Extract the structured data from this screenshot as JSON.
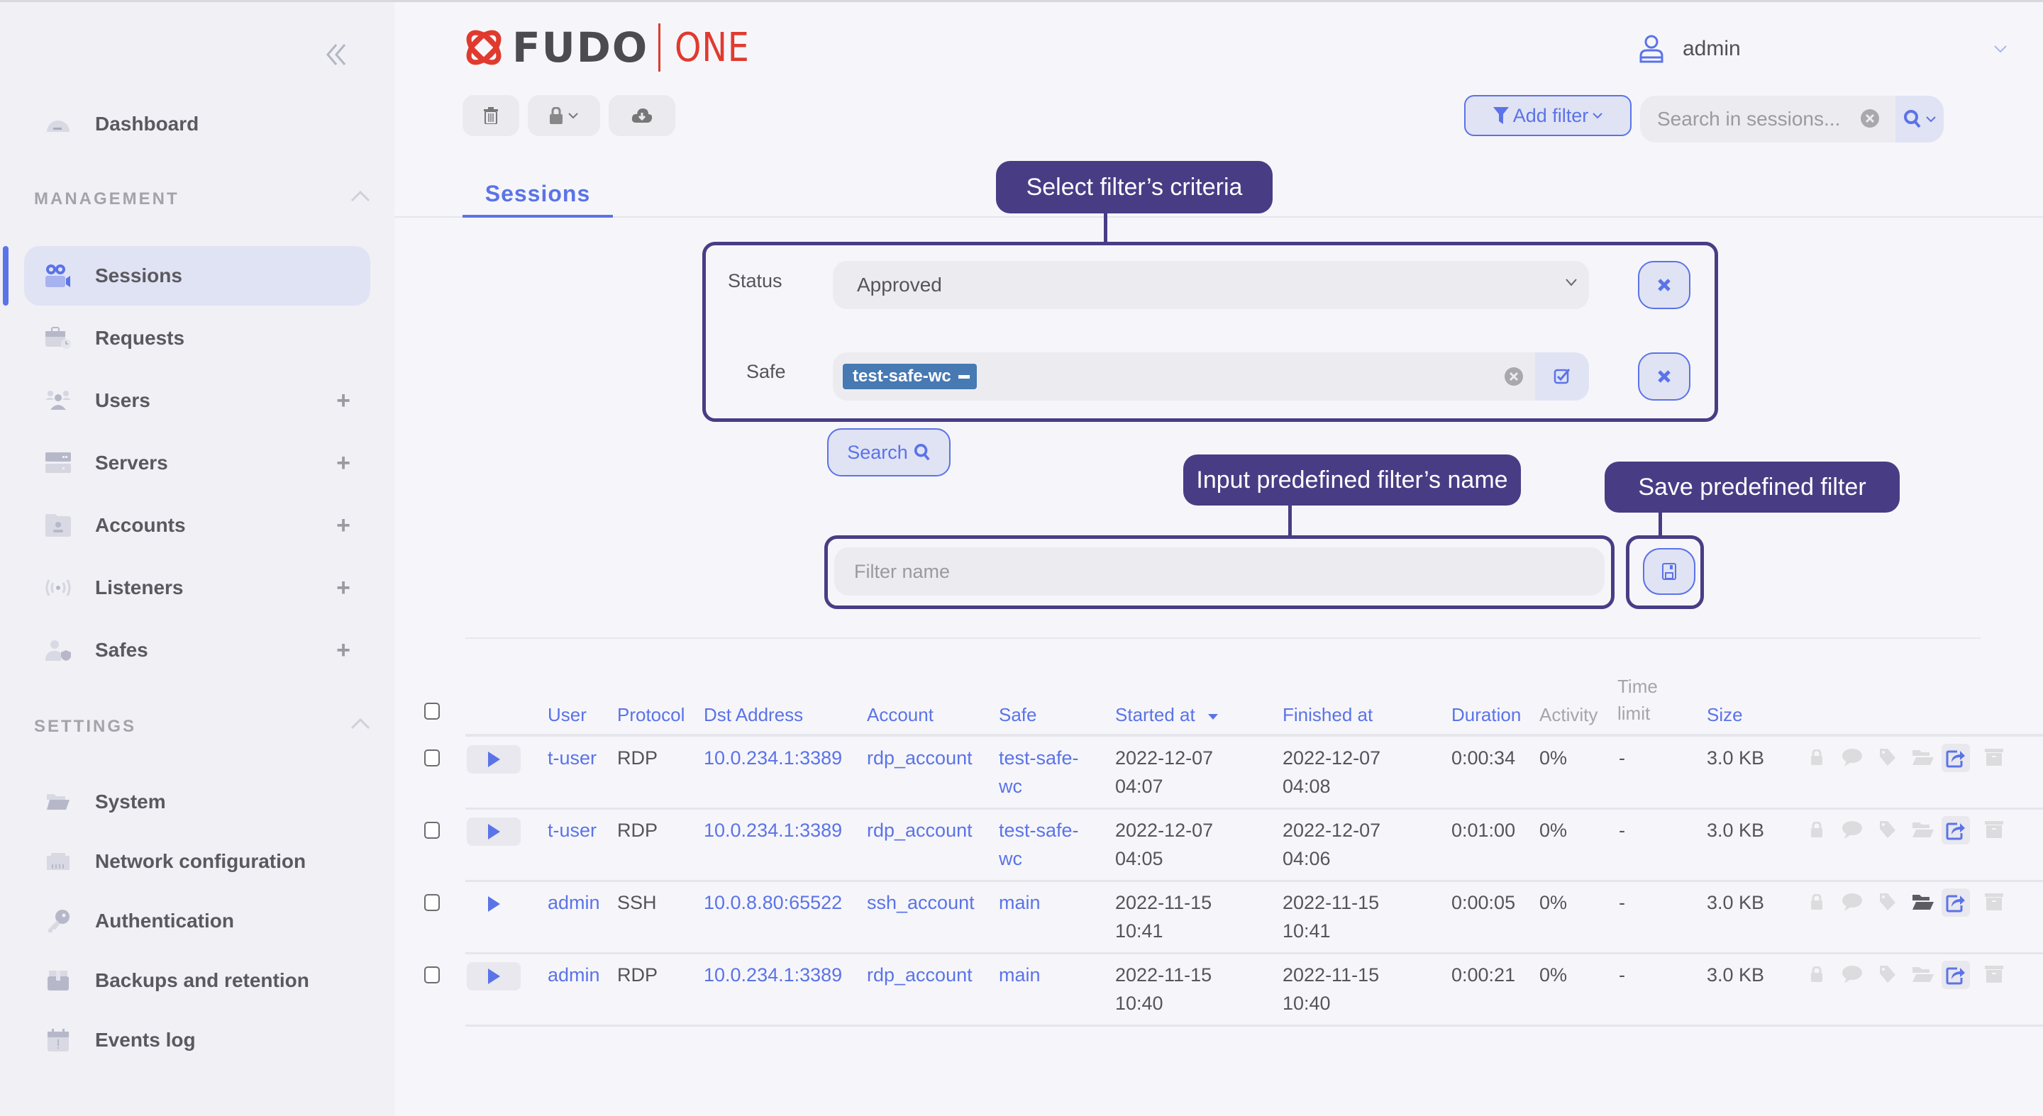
{
  "app": {
    "logo_brand": "FUDO",
    "logo_product": "ONE",
    "brand_color": "#e03a2f",
    "accent_color": "#5b73e8",
    "annotation_color": "#483d85"
  },
  "sidebar": {
    "collapse_icon": "double-chevron-left-icon",
    "top_items": [
      {
        "label": "Dashboard",
        "icon": "gauge-icon"
      }
    ],
    "sections": [
      {
        "title": "MANAGEMENT",
        "items": [
          {
            "label": "Sessions",
            "icon": "video-camera-icon",
            "active": true,
            "has_add": false
          },
          {
            "label": "Requests",
            "icon": "briefcase-clock-icon",
            "has_add": false
          },
          {
            "label": "Users",
            "icon": "users-icon",
            "has_add": true
          },
          {
            "label": "Servers",
            "icon": "server-icon",
            "has_add": true
          },
          {
            "label": "Accounts",
            "icon": "account-folder-icon",
            "has_add": true
          },
          {
            "label": "Listeners",
            "icon": "broadcast-icon",
            "has_add": true
          },
          {
            "label": "Safes",
            "icon": "user-shield-icon",
            "has_add": true
          }
        ]
      },
      {
        "title": "SETTINGS",
        "items": [
          {
            "label": "System",
            "icon": "folder-open-icon"
          },
          {
            "label": "Network configuration",
            "icon": "ethernet-icon"
          },
          {
            "label": "Authentication",
            "icon": "key-icon"
          },
          {
            "label": "Backups and retention",
            "icon": "box-icon"
          },
          {
            "label": "Events log",
            "icon": "calendar-alert-icon"
          }
        ]
      }
    ]
  },
  "header": {
    "user": "admin",
    "toolbar": {
      "delete_icon": "trash-icon",
      "lock_icon": "lock-icon",
      "download_icon": "cloud-download-icon"
    },
    "add_filter_label": "Add filter",
    "search_placeholder": "Search in sessions..."
  },
  "tabs": [
    {
      "label": "Sessions",
      "active": true
    }
  ],
  "filters": {
    "rows": [
      {
        "label": "Status",
        "type": "select",
        "value": "Approved"
      },
      {
        "label": "Safe",
        "type": "tags",
        "tags": [
          "test-safe-wc"
        ]
      }
    ],
    "search_label": "Search",
    "filter_name_placeholder": "Filter name"
  },
  "annotations": {
    "criteria": "Select filter’s criteria",
    "name": "Input predefined filter’s name",
    "save": "Save predefined filter"
  },
  "table": {
    "columns": {
      "user": "User",
      "protocol": "Protocol",
      "dst": "Dst Address",
      "account": "Account",
      "safe": "Safe",
      "started": "Started at",
      "finished": "Finished at",
      "duration": "Duration",
      "activity": "Activity",
      "time_limit_1": "Time",
      "time_limit_2": "limit",
      "size": "Size"
    },
    "sort": {
      "column": "Started at",
      "direction": "desc"
    },
    "rows": [
      {
        "user": "t-user",
        "protocol": "RDP",
        "dst": "10.0.234.1:3389",
        "account": "rdp_account",
        "safe_1": "test-safe-",
        "safe_2": "wc",
        "started_date": "2022-12-07",
        "started_time": "04:07",
        "finished_date": "2022-12-07",
        "finished_time": "04:08",
        "duration": "0:00:34",
        "activity": "0%",
        "time_limit": "-",
        "size": "3.0 KB",
        "folder_active": false,
        "play_bg": true
      },
      {
        "user": "t-user",
        "protocol": "RDP",
        "dst": "10.0.234.1:3389",
        "account": "rdp_account",
        "safe_1": "test-safe-",
        "safe_2": "wc",
        "started_date": "2022-12-07",
        "started_time": "04:05",
        "finished_date": "2022-12-07",
        "finished_time": "04:06",
        "duration": "0:01:00",
        "activity": "0%",
        "time_limit": "-",
        "size": "3.0 KB",
        "folder_active": false,
        "play_bg": true
      },
      {
        "user": "admin",
        "protocol": "SSH",
        "dst": "10.0.8.80:65522",
        "account": "ssh_account",
        "safe_1": "main",
        "safe_2": "",
        "started_date": "2022-11-15",
        "started_time": "10:41",
        "finished_date": "2022-11-15",
        "finished_time": "10:41",
        "duration": "0:00:05",
        "activity": "0%",
        "time_limit": "-",
        "size": "3.0 KB",
        "folder_active": true,
        "play_bg": false
      },
      {
        "user": "admin",
        "protocol": "RDP",
        "dst": "10.0.234.1:3389",
        "account": "rdp_account",
        "safe_1": "main",
        "safe_2": "",
        "started_date": "2022-11-15",
        "started_time": "10:40",
        "finished_date": "2022-11-15",
        "finished_time": "10:40",
        "duration": "0:00:21",
        "activity": "0%",
        "time_limit": "-",
        "size": "3.0 KB",
        "folder_active": false,
        "play_bg": true
      }
    ],
    "row_actions": [
      "lock-icon",
      "comment-icon",
      "tag-icon",
      "folder-open-icon",
      "share-icon",
      "archive-icon"
    ]
  }
}
